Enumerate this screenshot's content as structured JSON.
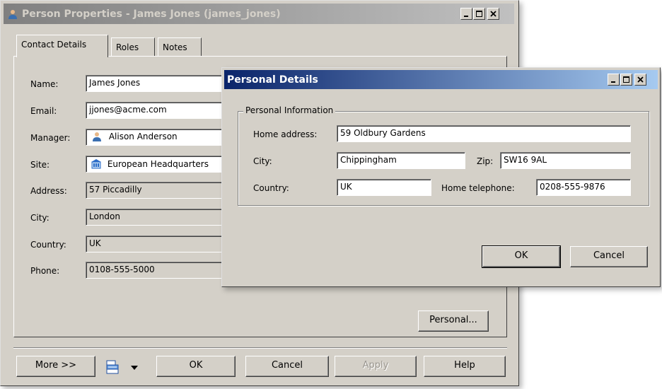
{
  "main": {
    "title": "Person Properties - James Jones (james_jones)",
    "tabs": [
      {
        "label": "Contact Details",
        "active": true
      },
      {
        "label": "Roles",
        "active": false
      },
      {
        "label": "Notes",
        "active": false
      }
    ],
    "fields": {
      "name": {
        "label": "Name:",
        "value": "James Jones"
      },
      "email": {
        "label": "Email:",
        "value": "jjones@acme.com"
      },
      "manager": {
        "label": "Manager:",
        "value": "Alison Anderson",
        "icon": "person-icon"
      },
      "site": {
        "label": "Site:",
        "value": "European Headquarters",
        "icon": "building-icon"
      },
      "address": {
        "label": "Address:",
        "value": "57 Piccadilly"
      },
      "city": {
        "label": "City:",
        "value": "London"
      },
      "country": {
        "label": "Country:",
        "value": "UK"
      },
      "phone": {
        "label": "Phone:",
        "value": "0108-555-5000"
      }
    },
    "personal_button": "Personal...",
    "buttons": {
      "more": "More >>",
      "ok": "OK",
      "cancel": "Cancel",
      "apply": "Apply",
      "help": "Help"
    },
    "apply_disabled": true
  },
  "personal_details": {
    "title": "Personal Details",
    "group_label": "Personal Information",
    "home_address": {
      "label": "Home address:",
      "value": "59 Oldbury Gardens"
    },
    "city": {
      "label": "City:",
      "value": "Chippingham"
    },
    "zip": {
      "label": "Zip:",
      "value": "SW16 9AL"
    },
    "country": {
      "label": "Country:",
      "value": "UK"
    },
    "home_telephone": {
      "label": "Home telephone:",
      "value": "0208-555-9876"
    },
    "ok": "OK",
    "cancel": "Cancel"
  },
  "window_controls": {
    "minimize": "_",
    "maximize": "□",
    "close": "×"
  },
  "colors": {
    "face": "#d4d0c8",
    "active_title_start": "#0a246a",
    "active_title_end": "#a6caf0",
    "inactive_title_start": "#808080",
    "inactive_title_end": "#c0c0c0"
  }
}
